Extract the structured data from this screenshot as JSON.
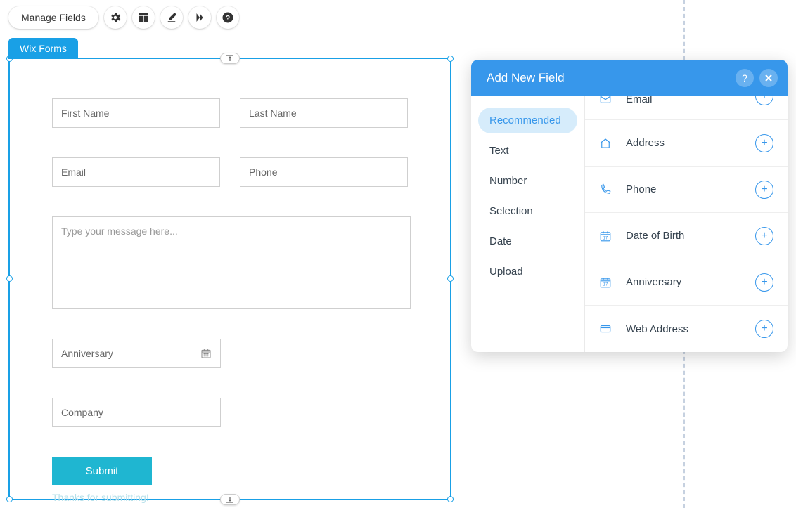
{
  "toolbar": {
    "manage_fields": "Manage Fields"
  },
  "tab": {
    "label": "Wix Forms"
  },
  "form": {
    "first_name": "First Name",
    "last_name": "Last Name",
    "email": "Email",
    "phone": "Phone",
    "message": "Type your message here...",
    "anniversary": "Anniversary",
    "company": "Company",
    "submit": "Submit",
    "thanks": "Thanks for submitting!"
  },
  "panel": {
    "title": "Add New Field",
    "categories": [
      {
        "label": "Recommended",
        "active": true
      },
      {
        "label": "Text"
      },
      {
        "label": "Number"
      },
      {
        "label": "Selection"
      },
      {
        "label": "Date"
      },
      {
        "label": "Upload"
      }
    ],
    "email_partial": "Email",
    "fields": [
      {
        "icon": "home",
        "label": "Address"
      },
      {
        "icon": "phone",
        "label": "Phone"
      },
      {
        "icon": "calendar",
        "label": "Date of Birth"
      },
      {
        "icon": "calendar",
        "label": "Anniversary"
      },
      {
        "icon": "card",
        "label": "Web Address"
      }
    ]
  }
}
